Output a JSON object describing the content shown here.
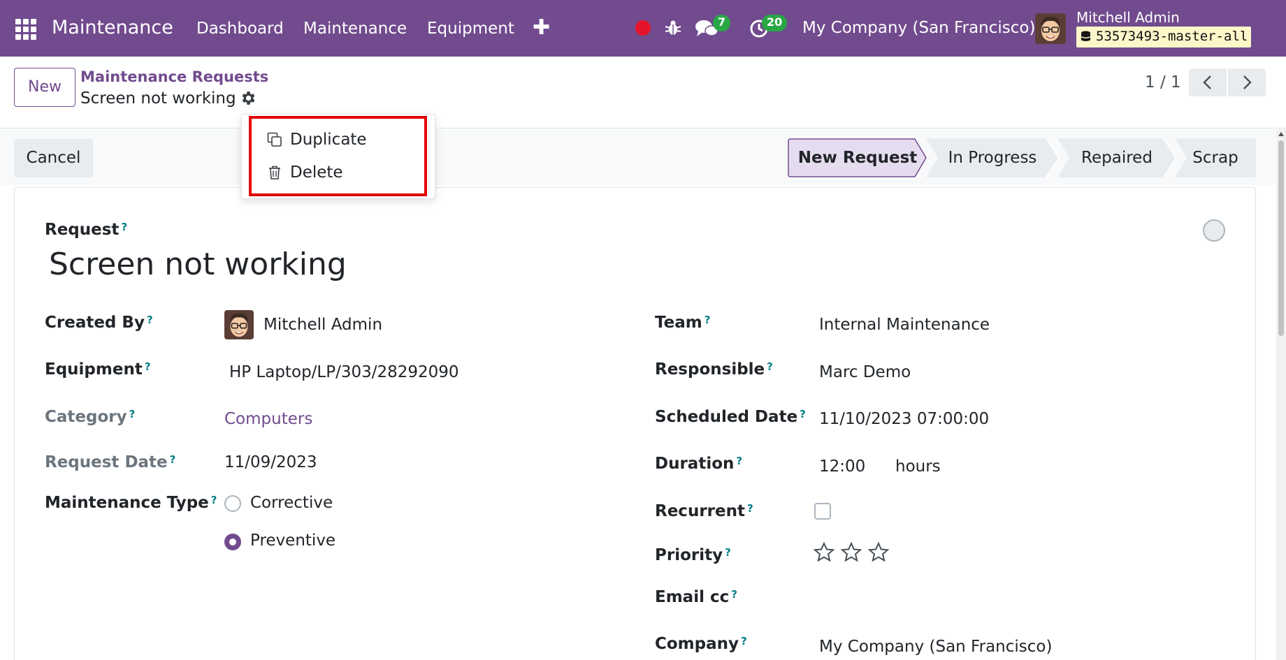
{
  "navbar": {
    "brand": "Maintenance",
    "menu": [
      "Dashboard",
      "Maintenance",
      "Equipment"
    ],
    "plus": "✚",
    "chat_count": "7",
    "activity_count": "20",
    "company": "My Company (San Francisco)",
    "user_name": "Mitchell Admin",
    "db_name": "53573493-master-all"
  },
  "control_panel": {
    "new_label": "New",
    "breadcrumb_parent": "Maintenance Requests",
    "breadcrumb_current": "Screen not working",
    "pager": "1 / 1"
  },
  "dropdown": {
    "duplicate": "Duplicate",
    "delete": "Delete"
  },
  "statusbar": {
    "cancel_label": "Cancel",
    "stages": [
      "New Request",
      "In Progress",
      "Repaired",
      "Scrap"
    ],
    "active_stage": "New Request"
  },
  "form": {
    "request_label": "Request",
    "help": "?",
    "request_name": "Screen not working",
    "left": {
      "created_by_label": "Created By",
      "created_by": "Mitchell Admin",
      "equipment_label": "Equipment",
      "equipment": "HP Laptop/LP/303/28292090",
      "category_label": "Category",
      "category": "Computers",
      "request_date_label": "Request Date",
      "request_date": "11/09/2023",
      "maintenance_type_label": "Maintenance Type",
      "types": [
        "Corrective",
        "Preventive"
      ],
      "selected_type": "Preventive"
    },
    "right": {
      "team_label": "Team",
      "team": "Internal Maintenance",
      "responsible_label": "Responsible",
      "responsible": "Marc Demo",
      "scheduled_label": "Scheduled Date",
      "scheduled": "11/10/2023 07:00:00",
      "duration_label": "Duration",
      "duration": "12:00",
      "duration_unit": "hours",
      "recurrent_label": "Recurrent",
      "recurrent": false,
      "priority_label": "Priority",
      "priority_stars": 0,
      "priority_max": 3,
      "email_cc_label": "Email cc",
      "company_label": "Company",
      "company": "My Company (San Francisco)"
    }
  },
  "colors": {
    "brand": "#714b8e",
    "badge": "#28a745",
    "highlight": "#e30000",
    "record": "#e5142b"
  }
}
